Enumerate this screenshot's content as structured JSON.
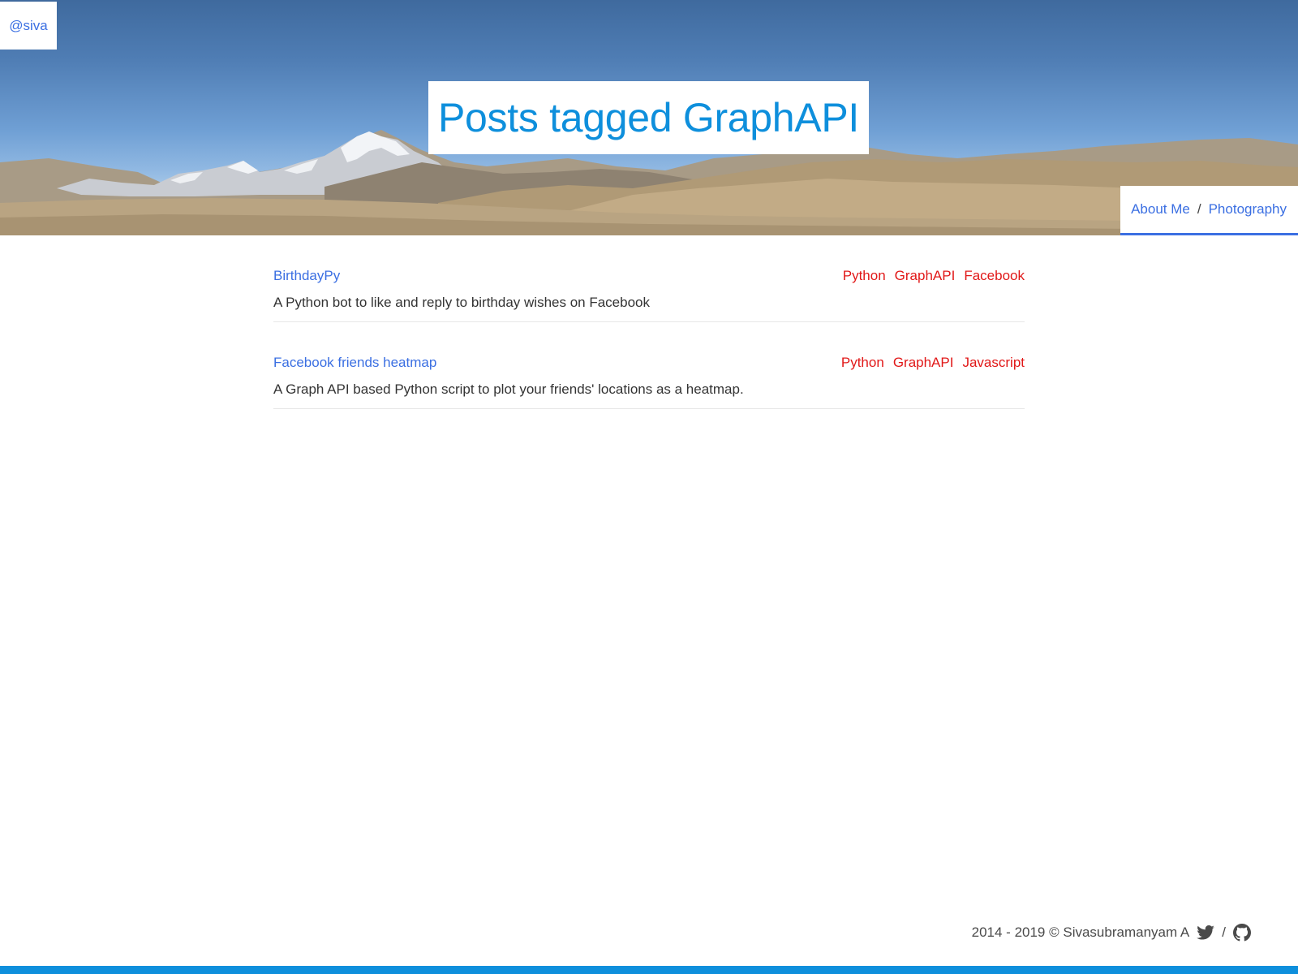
{
  "brand": {
    "label": "@siva"
  },
  "hero": {
    "title": "Posts tagged GraphAPI"
  },
  "nav": {
    "items": [
      {
        "label": "About Me"
      },
      {
        "label": "Photography"
      }
    ],
    "separator": "/"
  },
  "posts": [
    {
      "title": "BirthdayPy",
      "description": "A Python bot to like and reply to birthday wishes on Facebook",
      "tags": [
        "Python",
        "GraphAPI",
        "Facebook"
      ]
    },
    {
      "title": "Facebook friends heatmap",
      "description": "A Graph API based Python script to plot your friends' locations as a heatmap.",
      "tags": [
        "Python",
        "GraphAPI",
        "Javascript"
      ]
    }
  ],
  "footer": {
    "copyright": "2014 - 2019 © Sivasubramanyam A",
    "separator": "/",
    "icons": [
      "twitter-icon",
      "github-icon"
    ]
  },
  "colors": {
    "link": "#3b6fe2",
    "title": "#0e8fdc",
    "tag": "#e11818",
    "bottom_bar": "#0e8fdc"
  }
}
